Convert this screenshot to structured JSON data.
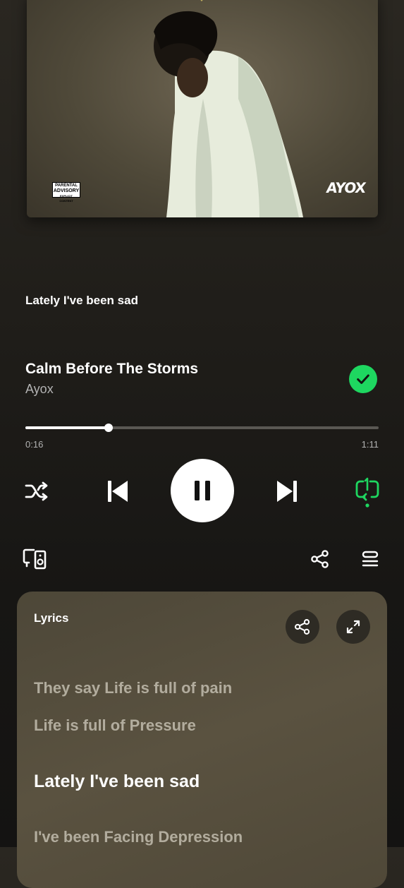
{
  "album_art": {
    "advisory": [
      "PARENTAL",
      "ADVISORY",
      "EXPLICIT CONTENT"
    ],
    "logo_text": "AYOX"
  },
  "current_lyric_line": "Lately I've been sad",
  "track": {
    "title": "Calm Before The Storms",
    "artist": "Ayox",
    "liked": true
  },
  "playback": {
    "elapsed": "0:16",
    "total": "1:11",
    "progress_fraction": 0.235,
    "is_playing": true,
    "repeat_mode": "repeat-one"
  },
  "lyrics": {
    "heading": "Lyrics",
    "lines": [
      {
        "text": "They say Life is full of pain",
        "active": false
      },
      {
        "text": "Life is full of Pressure",
        "active": false
      },
      {
        "text": "Lately I've been sad",
        "active": true
      },
      {
        "text": "I've been Facing Depression",
        "active": false
      }
    ]
  },
  "colors": {
    "accent": "#1ed760",
    "background": "#1f1d19",
    "lyrics_card": "#554e3d"
  }
}
